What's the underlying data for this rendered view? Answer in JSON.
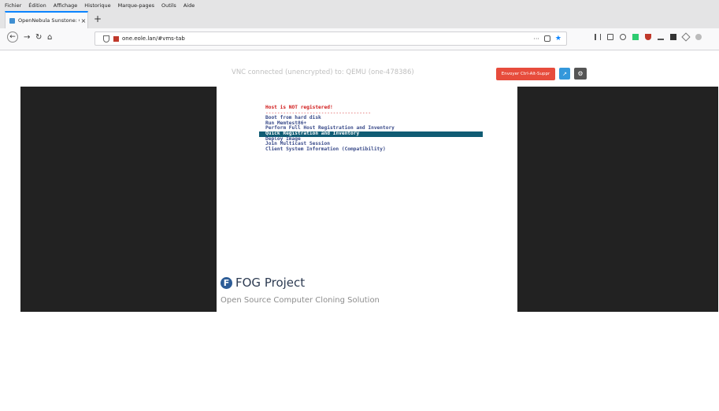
{
  "menu": {
    "items": [
      "Fichier",
      "Édition",
      "Affichage",
      "Historique",
      "Marque-pages",
      "Outils",
      "Aide"
    ]
  },
  "tab": {
    "title": "OpenNebula Sunstone: C",
    "close": "×",
    "new": "+"
  },
  "nav": {
    "url": "one.eole.lan/#vms-tab",
    "dots": "···"
  },
  "vnc": {
    "status": "VNC connected (unencrypted) to: QEMU (one-478386)",
    "ctrl_alt_label": "Envoyer Ctrl-Alt-Suppr"
  },
  "boot": {
    "title": "Host is NOT registered!",
    "separator": "------------------------------------",
    "items": [
      "Boot from hard disk",
      "Run Memtest86+",
      "Perform Full Host Registration and Inventory",
      "Quick Registration and Inventory",
      "Deploy Image",
      "Join Multicast Session",
      "Client System Information (Compatibility)"
    ],
    "selected_index": 3
  },
  "fog": {
    "logo_letter": "F",
    "title": "FOG Project",
    "subtitle": "Open Source Computer Cloning Solution"
  }
}
